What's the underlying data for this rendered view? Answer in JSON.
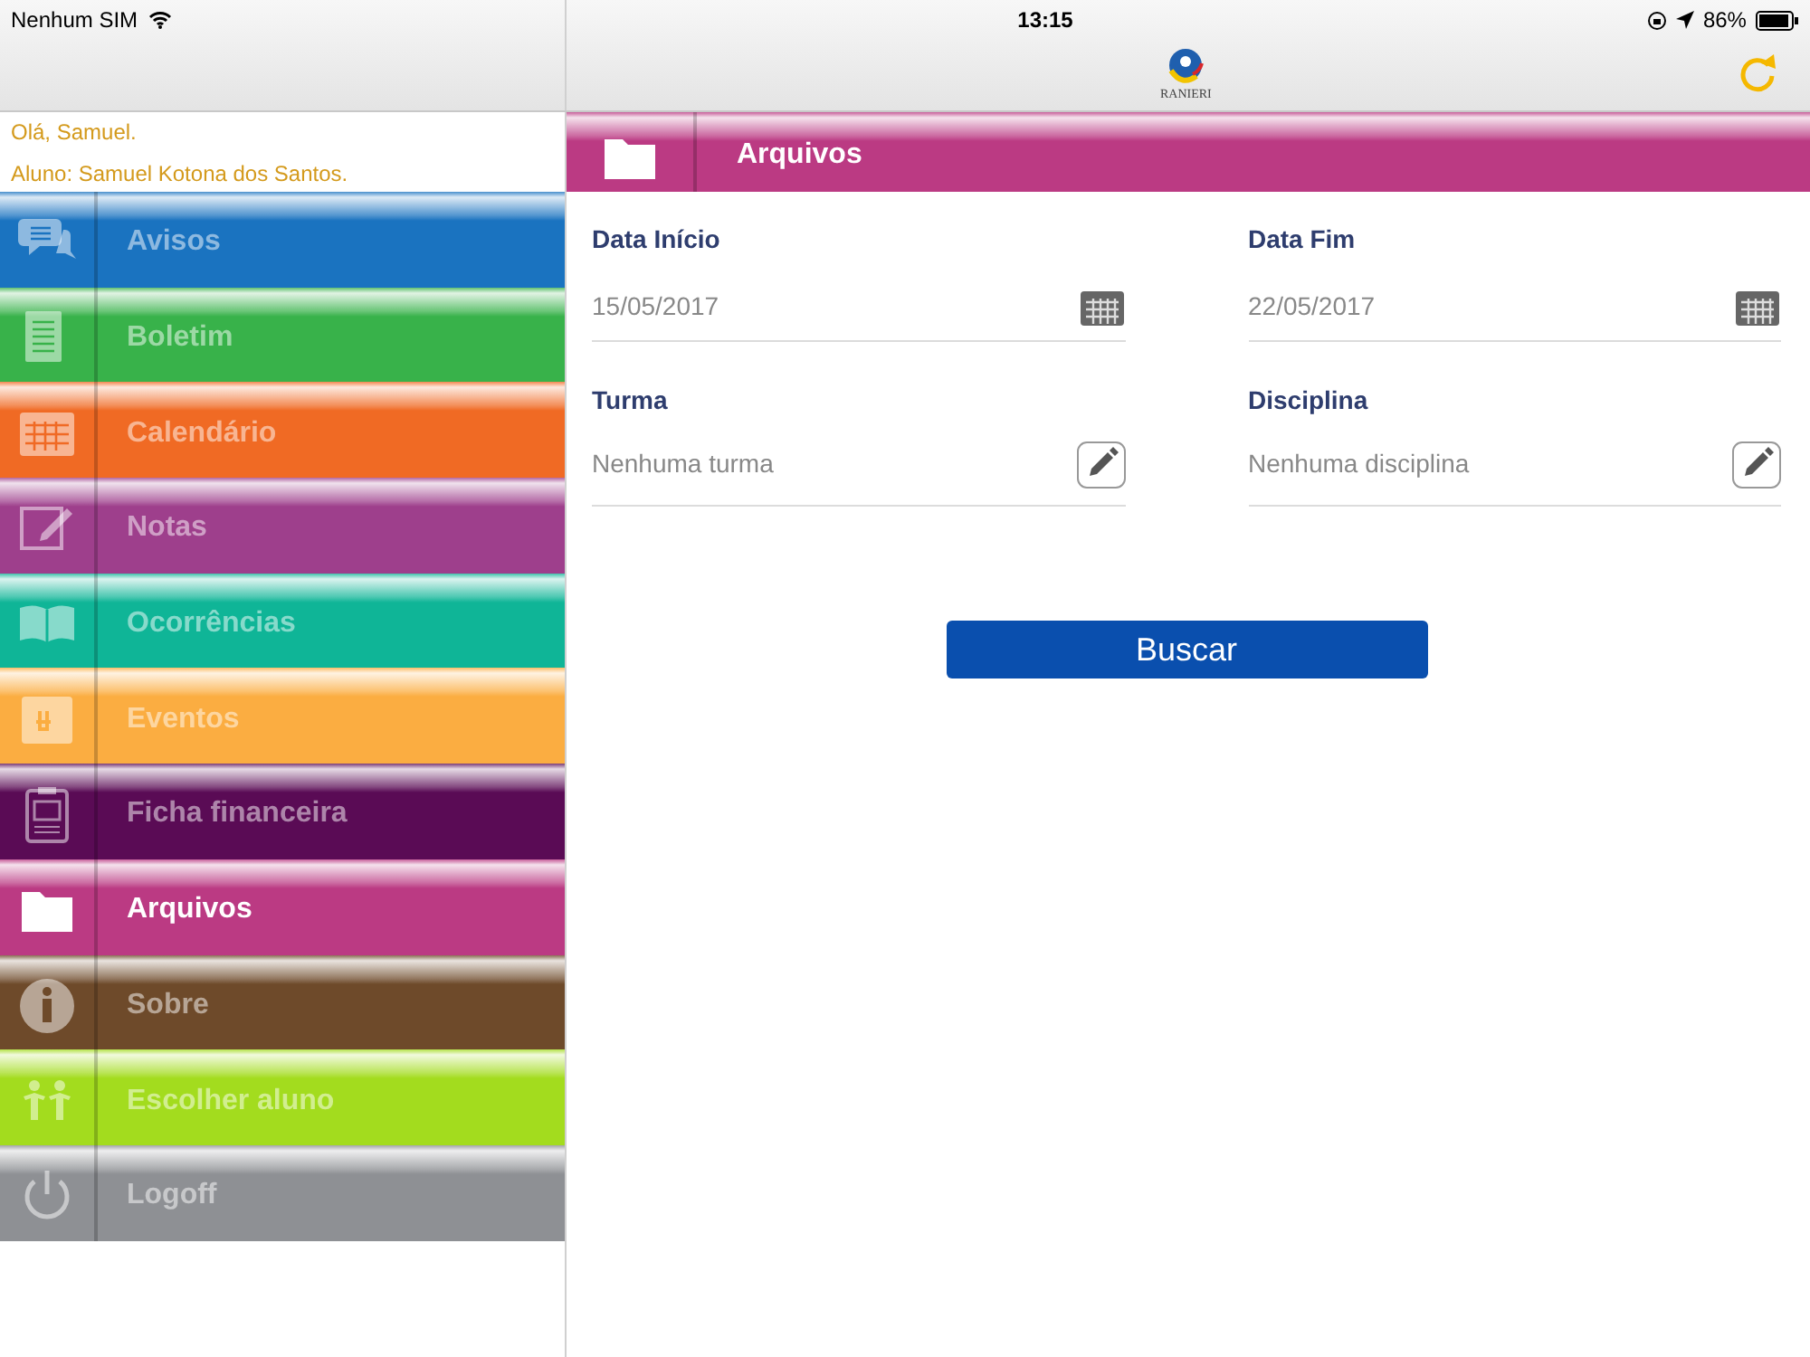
{
  "status_bar": {
    "carrier": "Nenhum SIM",
    "time": "13:15",
    "battery": "86%"
  },
  "nav_bar": {
    "logo_text": "RANIERI"
  },
  "greeting": {
    "hello": "Olá, Samuel.",
    "student": "Aluno: Samuel Kotona dos Santos."
  },
  "menu": [
    {
      "label": "Avisos",
      "kind": "chat",
      "color": "#1a73c0",
      "selected": false
    },
    {
      "label": "Boletim",
      "kind": "document",
      "color": "#38b24a",
      "selected": false
    },
    {
      "label": "Calendário",
      "kind": "calendar",
      "color": "#f06a24",
      "selected": false
    },
    {
      "label": "Notas",
      "kind": "edit",
      "color": "#9e3f8c",
      "selected": false
    },
    {
      "label": "Ocorrências",
      "kind": "book",
      "color": "#0fb597",
      "selected": false
    },
    {
      "label": "Eventos",
      "kind": "event",
      "color": "#fbad41",
      "selected": false
    },
    {
      "label": "Ficha financeira",
      "kind": "invoice",
      "color": "#5a0b55",
      "selected": false
    },
    {
      "label": "Arquivos",
      "kind": "folder",
      "color": "#bb3a83",
      "selected": true
    },
    {
      "label": "Sobre",
      "kind": "info",
      "color": "#6e4a2a",
      "selected": false
    },
    {
      "label": "Escolher aluno",
      "kind": "kids",
      "color": "#a3dc1e",
      "selected": false
    },
    {
      "label": "Logoff",
      "kind": "power",
      "color": "#8e9094",
      "selected": false
    }
  ],
  "page_header": {
    "title": "Arquivos",
    "kind": "folder"
  },
  "filters": [
    {
      "label": "Data Início",
      "value": "15/05/2017",
      "kind": "date"
    },
    {
      "label": "Data Fim",
      "value": "22/05/2017",
      "kind": "date"
    },
    {
      "label": "Turma",
      "value": "Nenhuma turma",
      "kind": "picker"
    },
    {
      "label": "Disciplina",
      "value": "Nenhuma disciplina",
      "kind": "picker"
    }
  ],
  "search_button": "Buscar"
}
